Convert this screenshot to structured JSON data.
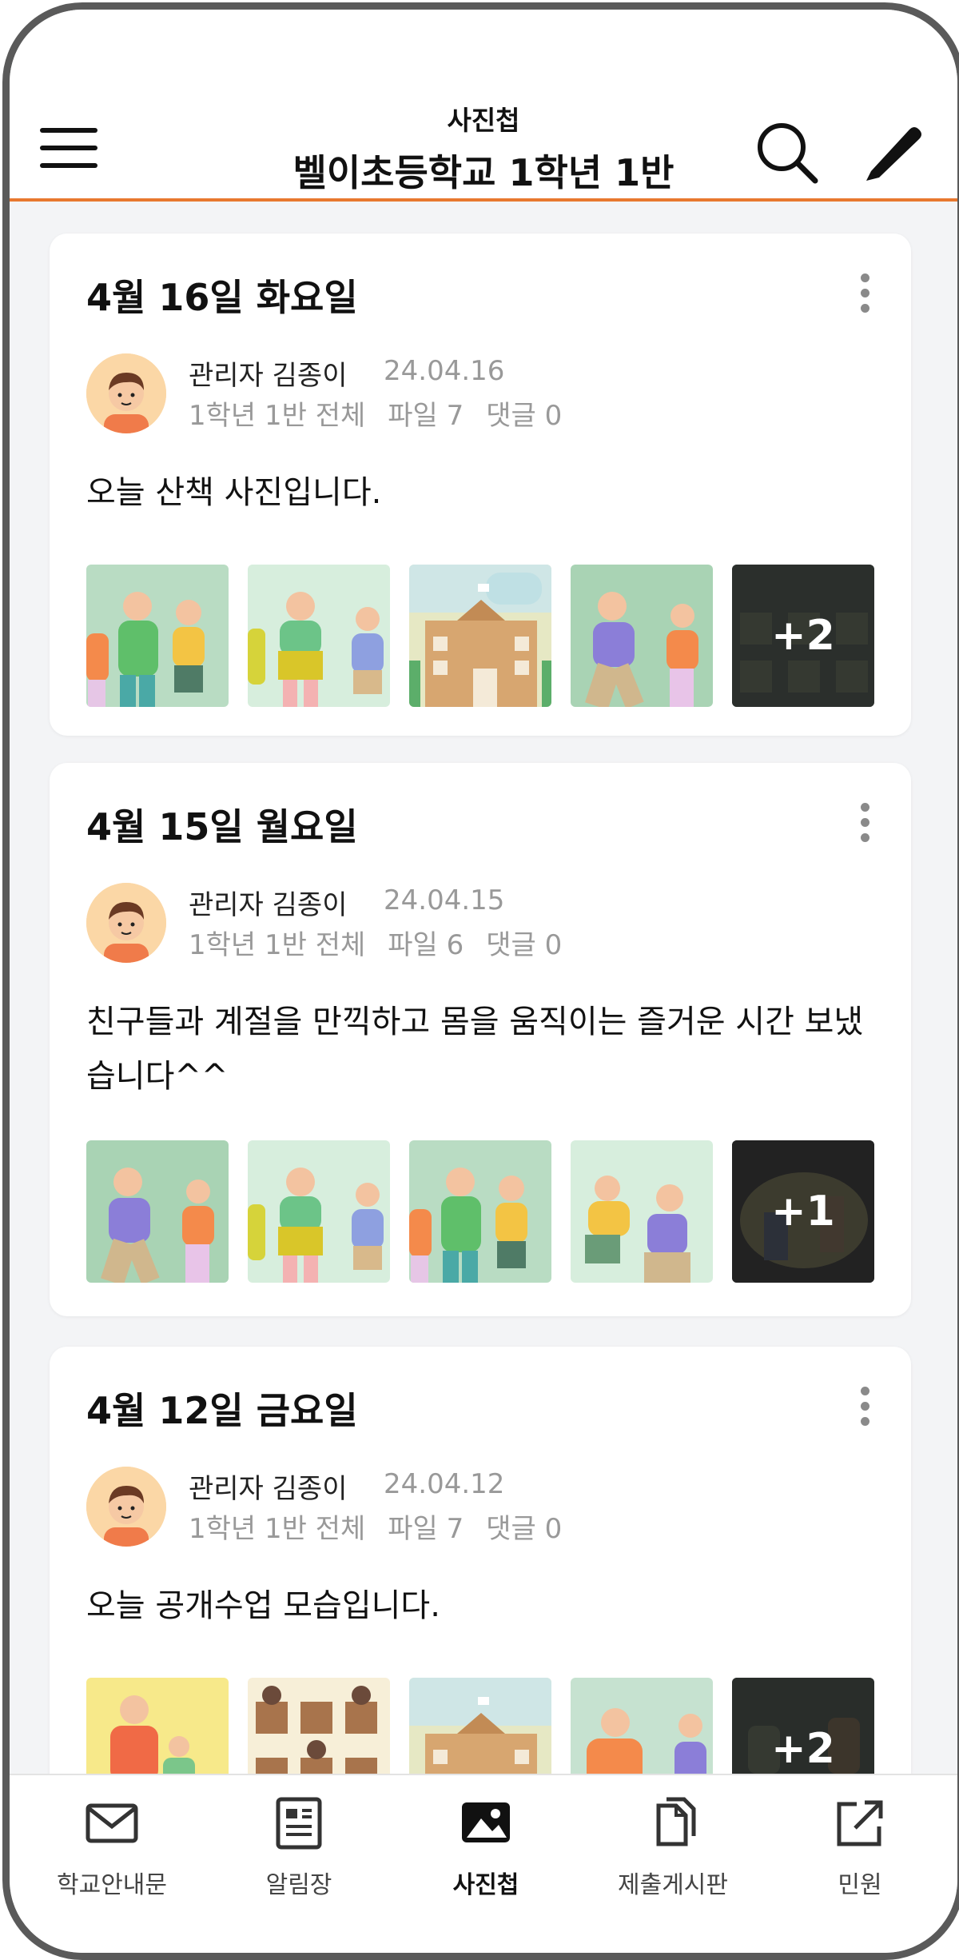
{
  "header": {
    "subtitle": "사진첩",
    "title": "벨이초등학교 1학년 1반"
  },
  "posts": [
    {
      "date": "4월 16일 화요일",
      "author": "관리자 김종이",
      "post_date": "24.04.16",
      "audience": "1학년 1반 전체",
      "files": "파일 7",
      "comments": "댓글 0",
      "text": "오늘 산책 사진입니다.",
      "more_count": "+2"
    },
    {
      "date": "4월 15일 월요일",
      "author": "관리자 김종이",
      "post_date": "24.04.15",
      "audience": "1학년 1반 전체",
      "files": "파일 6",
      "comments": "댓글 0",
      "text": "친구들과 계절을 만끽하고 몸을 움직이는 즐거운 시간 보냈습니다^^",
      "more_count": "+1"
    },
    {
      "date": "4월 12일 금요일",
      "author": "관리자 김종이",
      "post_date": "24.04.12",
      "audience": "1학년 1반 전체",
      "files": "파일 7",
      "comments": "댓글 0",
      "text": "오늘 공개수업 모습입니다.",
      "more_count": "+2"
    }
  ],
  "tabs": [
    {
      "label": "학교안내문",
      "icon": "mail-icon",
      "active": false
    },
    {
      "label": "알림장",
      "icon": "notice-icon",
      "active": false
    },
    {
      "label": "사진첩",
      "icon": "image-icon",
      "active": true
    },
    {
      "label": "제출게시판",
      "icon": "documents-icon",
      "active": false
    },
    {
      "label": "민원",
      "icon": "external-link-icon",
      "active": false
    }
  ],
  "colors": {
    "accent": "#e8782f",
    "background": "#f3f4f6",
    "muted_text": "#999999"
  }
}
